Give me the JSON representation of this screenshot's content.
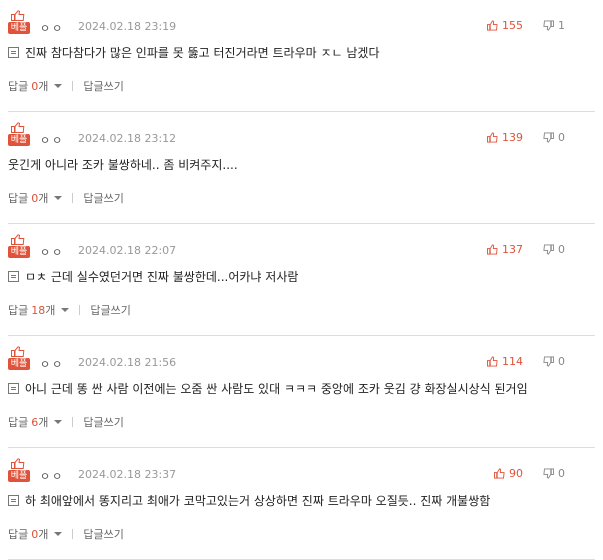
{
  "comments": [
    {
      "badge": "베플",
      "nick": "ㅇㅇ",
      "date": "2024.02.18 23:19",
      "has_image": true,
      "text": "진짜 참다참다가 많은 인파를 못 뚫고 터진거라면 트라우마 ㅈㄴ 남겠다",
      "up": "155",
      "down": "1",
      "reply_label": "답글",
      "reply_count": "0",
      "reply_unit": "개",
      "write_label": "답글쓰기"
    },
    {
      "badge": "베플",
      "nick": "ㅇㅇ",
      "date": "2024.02.18 23:12",
      "has_image": false,
      "text": "웃긴게 아니라 조카 불쌍하네.. 좀 비켜주지....",
      "up": "139",
      "down": "0",
      "reply_label": "답글",
      "reply_count": "0",
      "reply_unit": "개",
      "write_label": "답글쓰기"
    },
    {
      "badge": "베플",
      "nick": "ㅇㅇ",
      "date": "2024.02.18 22:07",
      "has_image": true,
      "text": "ㅁㅊ 근데 실수였던거면 진짜 불쌍한데...어카냐 저사람",
      "up": "137",
      "down": "0",
      "reply_label": "답글",
      "reply_count": "18",
      "reply_unit": "개",
      "write_label": "답글쓰기"
    },
    {
      "badge": "베플",
      "nick": "ㅇㅇ",
      "date": "2024.02.18 21:56",
      "has_image": true,
      "text": "아니 근데 똥 싼 사람 이전에는 오줌 싼 사람도 있대 ㅋㅋㅋ 중앙에 조카 웃김 걍 화장실시상식 된거임",
      "up": "114",
      "down": "0",
      "reply_label": "답글",
      "reply_count": "6",
      "reply_unit": "개",
      "write_label": "답글쓰기"
    },
    {
      "badge": "베플",
      "nick": "ㅇㅇ",
      "date": "2024.02.18 23:37",
      "has_image": true,
      "text": "하 최애앞에서 똥지리고 최애가 코막고있는거 상상하면 진짜 트라우마 오질듯.. 진짜 개불쌍함",
      "up": "90",
      "down": "0",
      "reply_label": "답글",
      "reply_count": "0",
      "reply_unit": "개",
      "write_label": "답글쓰기"
    }
  ],
  "colors": {
    "accent": "#e0523a",
    "divider": "#dddddd",
    "meta": "#999999"
  }
}
